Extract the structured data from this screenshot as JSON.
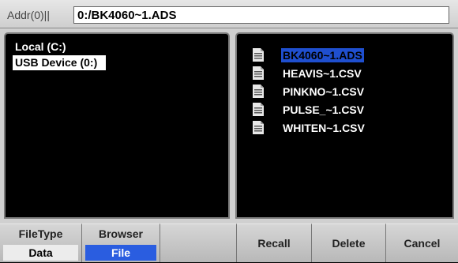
{
  "address": {
    "label": "Addr(0)||",
    "value": "0:/BK4060~1.ADS"
  },
  "drives": [
    {
      "label": "Local (C:)",
      "selected": false
    },
    {
      "label": "USB Device (0:)",
      "selected": true
    }
  ],
  "files": [
    {
      "name": "BK4060~1.ADS",
      "icon": "document-icon",
      "selected": true
    },
    {
      "name": "HEAVIS~1.CSV",
      "icon": "document-icon",
      "selected": false
    },
    {
      "name": "PINKNO~1.CSV",
      "icon": "document-icon",
      "selected": false
    },
    {
      "name": "PULSE_~1.CSV",
      "icon": "document-icon",
      "selected": false
    },
    {
      "name": "WHITEN~1.CSV",
      "icon": "document-icon",
      "selected": false
    }
  ],
  "softkeys": {
    "filetype": {
      "label": "FileType",
      "value": "Data"
    },
    "browser": {
      "label": "Browser",
      "value": "File"
    },
    "recall": {
      "label": "Recall"
    },
    "delete": {
      "label": "Delete"
    },
    "cancel": {
      "label": "Cancel"
    }
  },
  "colors": {
    "selection_blue": "#2a5de0",
    "background": "#000000",
    "panel_gray": "#d0d0d0"
  }
}
